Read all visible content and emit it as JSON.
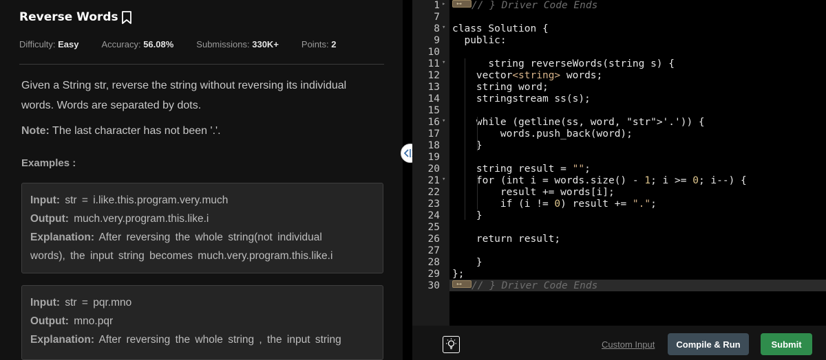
{
  "problem": {
    "title": "Reverse Words",
    "bookmark_icon": "bookmark-icon",
    "meta": [
      {
        "label": "Difficulty:",
        "value": "Easy"
      },
      {
        "label": "Accuracy:",
        "value": "56.08%"
      },
      {
        "label": "Submissions:",
        "value": "330K+"
      },
      {
        "label": "Points:",
        "value": "2"
      }
    ],
    "description_line1": "Given a String str, reverse the string without reversing its individual",
    "description_line2": "words. Words are separated by dots.",
    "note_label": "Note:",
    "note_text": "The last character has not been '.'.",
    "examples_heading": "Examples :",
    "examples": [
      {
        "input_label": "Input:",
        "input_text": "str = i.like.this.program.very.much",
        "output_label": "Output:",
        "output_text": "much.very.program.this.like.i",
        "explanation_label": "Explanation:",
        "explanation_line1": "After reversing the whole string(not individual",
        "explanation_line2": "words), the input string becomes much.very.program.this.like.i"
      },
      {
        "input_label": "Input:",
        "input_text": "str = pqr.mno",
        "output_label": "Output:",
        "output_text": "mno.pqr",
        "explanation_label": "Explanation:",
        "explanation_line1": "After reversing the whole string , the input string"
      }
    ]
  },
  "splitter_icon": "split-arrows-icon",
  "editor": {
    "line_numbers": [
      "1",
      "7",
      "8",
      "9",
      "10",
      "11",
      "12",
      "13",
      "14",
      "15",
      "16",
      "17",
      "18",
      "19",
      "20",
      "21",
      "22",
      "23",
      "24",
      "25",
      "26",
      "27",
      "28",
      "29",
      "30"
    ],
    "fold_lines": [
      "1",
      "8",
      "11",
      "16",
      "21"
    ],
    "lines": [
      "// } Driver Code Ends",
      "",
      "class Solution {",
      "  public:",
      "",
      "      string reverseWords(string s) {",
      "    vector<string> words;",
      "    string word;",
      "    stringstream ss(s);",
      "",
      "    while (getline(ss, word, '.')) {",
      "        words.push_back(word);",
      "    }",
      "",
      "    string result = \"\";",
      "    for (int i = words.size() - 1; i >= 0; i--) {",
      "        result += words[i];",
      "        if (i != 0) result += \".\";",
      "    }",
      "",
      "    return result;",
      "",
      "    }",
      "};",
      "// } Driver Code Ends"
    ]
  },
  "bottom_bar": {
    "hint_icon": "lightbulb-icon",
    "custom_input": "Custom Input",
    "compile_run": "Compile & Run",
    "submit": "Submit"
  }
}
